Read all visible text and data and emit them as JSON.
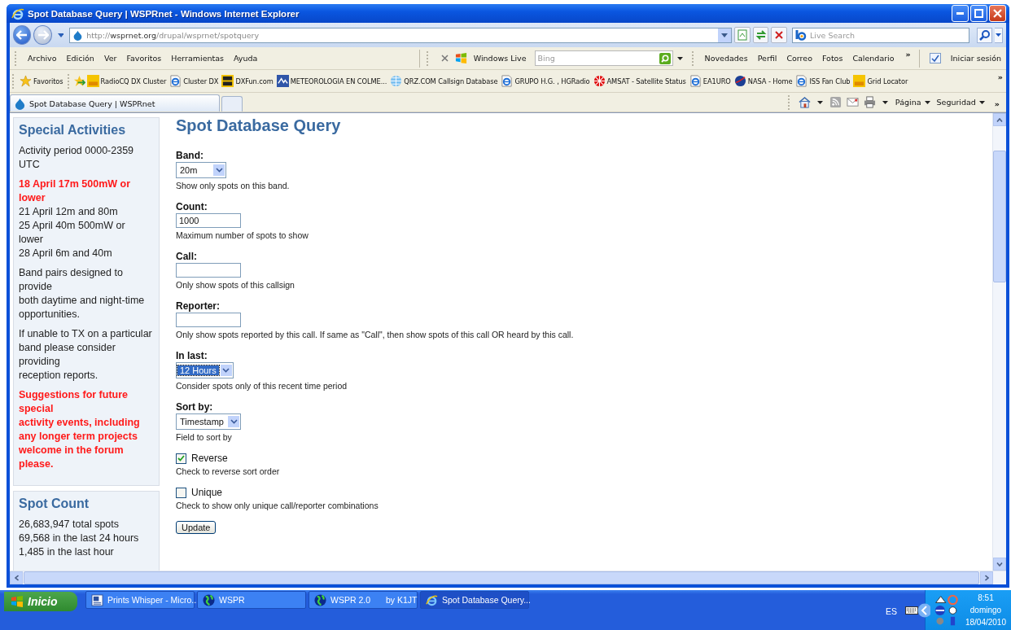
{
  "window": {
    "title": "Spot Database Query | WSPRnet - Windows Internet Explorer"
  },
  "address": {
    "prefix": "http://",
    "domain": "wsprnet.org",
    "path": "/drupal/wsprnet/spotquery"
  },
  "search": {
    "placeholder": "Live Search"
  },
  "menu": [
    "Archivo",
    "Edición",
    "Ver",
    "Favoritos",
    "Herramientas",
    "Ayuda"
  ],
  "live_toolbar": {
    "label": "Windows Live",
    "search_placeholder": "Bing",
    "links": [
      "Novedades",
      "Perfil",
      "Correo",
      "Fotos",
      "Calendario"
    ],
    "more": "»",
    "signin": "Iniciar sesión"
  },
  "favorites": {
    "label": "Favoritos",
    "more": "»",
    "items": [
      {
        "label": "RadioCQ DX Cluster",
        "kind": "radio"
      },
      {
        "label": "Cluster DX",
        "kind": "ie"
      },
      {
        "label": "DXFun.com",
        "kind": "dxfun"
      },
      {
        "label": "METEOROLOGIA EN COLME...",
        "kind": "meteo"
      },
      {
        "label": "QRZ.COM Callsign Database",
        "kind": "globe"
      },
      {
        "label": "GRUPO H.G. , HGRadio",
        "kind": "ie"
      },
      {
        "label": "AMSAT - Satellite Status",
        "kind": "amsat"
      },
      {
        "label": "EA1URO",
        "kind": "ie"
      },
      {
        "label": "NASA - Home",
        "kind": "nasa"
      },
      {
        "label": "ISS Fan Club",
        "kind": "ie"
      },
      {
        "label": "Grid Locator",
        "kind": "radio"
      }
    ]
  },
  "tabs": [
    {
      "label": "Spot Database Query | WSPRnet",
      "selected": true
    }
  ],
  "command_bar": {
    "buttons": [
      "Página",
      "Seguridad"
    ],
    "more": "»"
  },
  "sidebar": [
    {
      "title": "Special Activities",
      "paragraphs": [
        [
          {
            "text": "Activity period 0000-2359 UTC",
            "alert": false
          }
        ],
        [
          {
            "text": "18 April 17m 500mW or lower",
            "alert": true
          },
          {
            "text": "21 April 12m and 80m",
            "alert": false
          },
          {
            "text": "25 April 40m 500mW or",
            "alert": false
          },
          {
            "text": "lower",
            "alert": false
          },
          {
            "text": "28 April 6m and 40m",
            "alert": false
          }
        ],
        [
          {
            "text": "Band pairs designed to provide",
            "alert": false
          },
          {
            "text": "both daytime and night-time opportunities.",
            "alert": false
          }
        ],
        [
          {
            "text": "If unable to TX on a particular band please consider providing",
            "alert": false
          },
          {
            "text": "reception reports.",
            "alert": false
          }
        ],
        [
          {
            "text": "Suggestions for future special",
            "alert": true
          },
          {
            "text": "activity events, including any longer term projects welcome in the forum please.",
            "alert": true
          }
        ]
      ]
    },
    {
      "title": "Spot Count",
      "paragraphs": [
        [
          {
            "text": "26,683,947 total spots",
            "alert": false
          },
          {
            "text": "69,568 in the last 24 hours",
            "alert": false
          },
          {
            "text": "1,485 in the last hour",
            "alert": false
          }
        ]
      ]
    }
  ],
  "page_title": "Spot Database Query",
  "form": [
    {
      "kind": "select",
      "label": "Band:",
      "value": "20m",
      "focused": false,
      "help": "Show only spots on this band."
    },
    {
      "kind": "text",
      "label": "Count:",
      "value": "1000",
      "help": "Maximum number of spots to show"
    },
    {
      "kind": "text",
      "label": "Call:",
      "help": "Only show spots of this callsign"
    },
    {
      "kind": "text",
      "label": "Reporter:",
      "help": "Only show spots reported by this call. If same as \"Call\", then show spots of this call OR heard by this call."
    },
    {
      "kind": "select",
      "label": "In last:",
      "value": "12 Hours",
      "focused": true,
      "help": "Consider spots only of this recent time period"
    },
    {
      "kind": "select",
      "label": "Sort by:",
      "value": "Timestamp",
      "focused": false,
      "help": "Field to sort by"
    },
    {
      "kind": "checkbox",
      "label": "Reverse",
      "checked": true,
      "help": "Check to reverse sort order"
    },
    {
      "kind": "checkbox",
      "label": "Unique",
      "checked": false,
      "help": "Check to show only unique call/reporter combinations"
    },
    {
      "kind": "button",
      "label": "Update"
    }
  ],
  "taskbar": {
    "start": "Inicio",
    "tasks": [
      {
        "label": "Prints Whisper - Micro...",
        "kind": "document",
        "selected": false
      },
      {
        "label": "WSPR",
        "kind": "program",
        "selected": false
      },
      {
        "label": "WSPR 2.0",
        "extra": "by K1JT",
        "kind": "program",
        "selected": false
      },
      {
        "label": "Spot Database Query...",
        "kind": "browser",
        "selected": true
      }
    ],
    "language": "ES",
    "time": "8:51",
    "day": "domingo",
    "date": "18/04/2010"
  }
}
